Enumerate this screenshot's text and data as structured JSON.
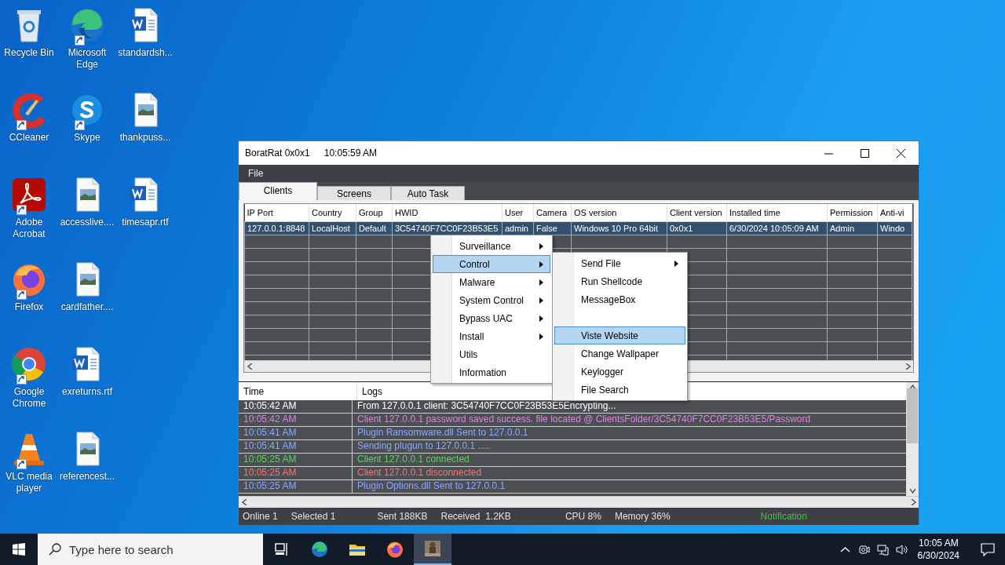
{
  "desktop": {
    "icons": [
      {
        "label": "Recycle Bin",
        "kind": "recycle",
        "shortcut": false
      },
      {
        "label": "CCleaner",
        "kind": "ccleaner",
        "shortcut": true
      },
      {
        "label": "Adobe Acrobat",
        "kind": "acrobat",
        "shortcut": true
      },
      {
        "label": "Firefox",
        "kind": "firefox",
        "shortcut": true
      },
      {
        "label": "Google Chrome",
        "kind": "chrome",
        "shortcut": true
      },
      {
        "label": "VLC media player",
        "kind": "vlc",
        "shortcut": true
      },
      {
        "label": "Microsoft Edge",
        "kind": "edge",
        "shortcut": true
      },
      {
        "label": "Skype",
        "kind": "skype",
        "shortcut": true
      },
      {
        "label": "accesslive....",
        "kind": "image",
        "shortcut": false
      },
      {
        "label": "cardfather....",
        "kind": "image",
        "shortcut": false
      },
      {
        "label": "exreturns.rtf",
        "kind": "word",
        "shortcut": false
      },
      {
        "label": "referencest...",
        "kind": "image",
        "shortcut": false
      },
      {
        "label": "standardsh...",
        "kind": "word",
        "shortcut": false
      },
      {
        "label": "thankpuss...",
        "kind": "image",
        "shortcut": false
      },
      {
        "label": "timesapr.rtf",
        "kind": "word",
        "shortcut": false
      }
    ]
  },
  "window": {
    "title": "BoratRat 0x0x1",
    "clock": "10:05:59 AM",
    "menu": [
      "File"
    ],
    "tabs": [
      {
        "label": "Clients",
        "selected": true
      },
      {
        "label": "Screens",
        "selected": false
      },
      {
        "label": "Auto Task",
        "selected": false
      }
    ],
    "clients": {
      "columns": [
        "IP Port",
        "Country",
        "Group",
        "HWID",
        "User",
        "Camera",
        "OS version",
        "Client version",
        "Installed time",
        "Permission",
        "Anti-vi"
      ],
      "rows": [
        {
          "selected": true,
          "cells": [
            "127.0.0.1:8848",
            "LocalHost",
            "Default",
            "3C54740F7CC0F23B53E5",
            "admin",
            "False",
            "Windows 10 Pro 64bit",
            "0x0x1",
            "6/30/2024 10:05:09 AM",
            "Admin",
            "Windo"
          ]
        }
      ]
    },
    "logs": {
      "columns": [
        "Time",
        "Logs"
      ],
      "rows": [
        {
          "time": "10:05:42 AM",
          "message": "From 127.0.0.1 client: 3C54740F7CC0F23B53E5Encrypting...",
          "color": "#ffffff"
        },
        {
          "time": "10:05:42 AM",
          "message": "Client 127.0.0.1 password saved success. file located @ ClientsFolder/3C54740F7CC0F23B53E5/Password",
          "color": "#e080e0"
        },
        {
          "time": "10:05:41 AM",
          "message": "Plugin Ransomware.dll Sent to 127.0.0.1",
          "color": "#8aa8ff"
        },
        {
          "time": "10:05:41 AM",
          "message": "Sending plugun to 127.0.0.1 .....",
          "color": "#8aa8ff"
        },
        {
          "time": "10:05:25 AM",
          "message": "Client 127.0.0.1 connected",
          "color": "#60d060"
        },
        {
          "time": "10:05:25 AM",
          "message": "Client 127.0.0.1 disconnected",
          "color": "#ff7070"
        },
        {
          "time": "10:05:25 AM",
          "message": "Plugin Options.dll Sent to 127.0.0.1",
          "color": "#8aa8ff"
        }
      ]
    },
    "status_bar": [
      {
        "text": "Online 1",
        "color": "#e0e0e0"
      },
      {
        "text": "Selected 1",
        "color": "#e0e0e0"
      },
      {
        "text": "Sent 188KB",
        "color": "#e0e0e0"
      },
      {
        "text": "Received  1.2KB",
        "color": "#e0e0e0"
      },
      {
        "text": "CPU 8%",
        "color": "#e0e0e0"
      },
      {
        "text": "Memory 36%",
        "color": "#e0e0e0"
      },
      {
        "text": "Notification",
        "color": "#40c040"
      }
    ]
  },
  "context_menu": {
    "items": [
      {
        "kind": "item",
        "label": "Surveillance",
        "submenu": true,
        "selected": false
      },
      {
        "kind": "item",
        "label": "Control",
        "submenu": true,
        "selected": true
      },
      {
        "kind": "item",
        "label": "Malware",
        "submenu": true,
        "selected": false
      },
      {
        "kind": "item",
        "label": "System Control",
        "submenu": true,
        "selected": false
      },
      {
        "kind": "item",
        "label": "Bypass UAC",
        "submenu": true,
        "selected": false
      },
      {
        "kind": "item",
        "label": "Install",
        "submenu": true,
        "selected": false
      },
      {
        "kind": "item",
        "label": "Utils",
        "submenu": false,
        "selected": false
      },
      {
        "kind": "item",
        "label": "Information",
        "submenu": false,
        "selected": false
      }
    ]
  },
  "submenu": {
    "items": [
      {
        "kind": "item",
        "label": "Send File",
        "submenu": true,
        "selected": false
      },
      {
        "kind": "item",
        "label": "Run Shellcode",
        "submenu": false,
        "selected": false
      },
      {
        "kind": "item",
        "label": "MessageBox",
        "submenu": false,
        "selected": false
      },
      {
        "kind": "blank"
      },
      {
        "kind": "item",
        "label": "Viste Website",
        "submenu": false,
        "selected": true
      },
      {
        "kind": "item",
        "label": "Change Wallpaper",
        "submenu": false,
        "selected": false
      },
      {
        "kind": "item",
        "label": "Keylogger",
        "submenu": false,
        "selected": false
      },
      {
        "kind": "item",
        "label": "File Search",
        "submenu": false,
        "selected": false
      }
    ]
  },
  "taskbar": {
    "search_placeholder": "Type here to search",
    "apps": [
      {
        "kind": "taskview",
        "active": false
      },
      {
        "kind": "edge",
        "active": false
      },
      {
        "kind": "folder",
        "active": false
      },
      {
        "kind": "firefox",
        "active": false
      },
      {
        "kind": "app",
        "active": true
      }
    ],
    "time": "10:05 AM",
    "date": "6/30/2024"
  }
}
